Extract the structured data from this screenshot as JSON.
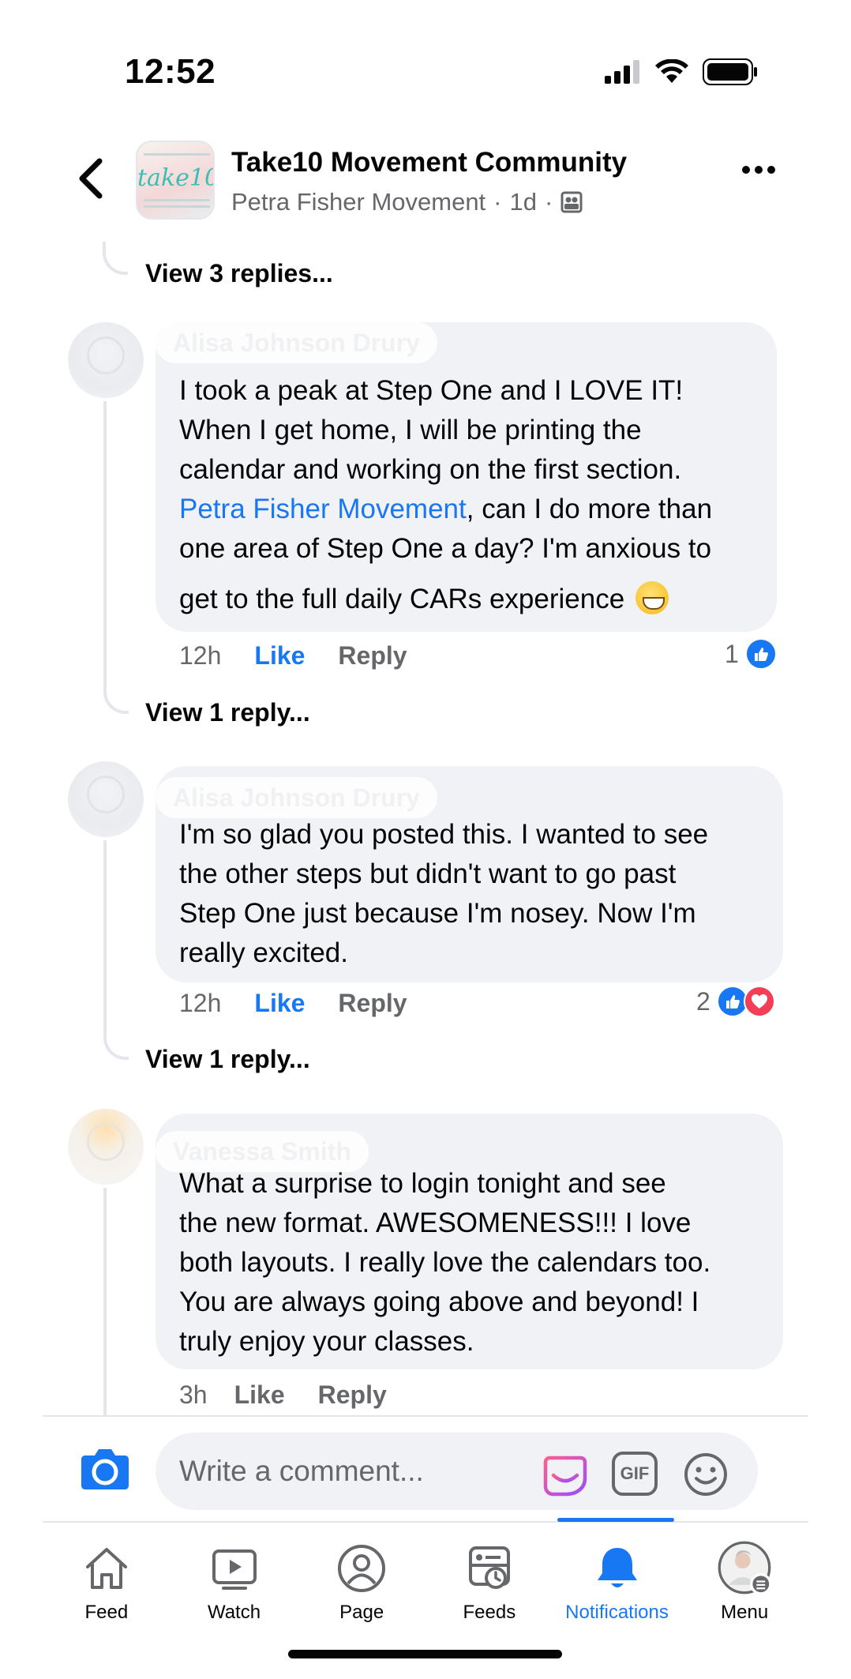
{
  "status_bar": {
    "time": "12:52"
  },
  "header": {
    "group_name": "Take10 Movement Community",
    "page_name": "Petra Fisher Movement",
    "separator": "·",
    "age": "1d",
    "avatar_text": "take10"
  },
  "thread": {
    "top_view_replies": "View 3 replies...",
    "comments": [
      {
        "author": "Alisa Johnson Drury",
        "lines": [
          "I took a peak at Step One and I LOVE IT!",
          "When I  get home, I will be printing the",
          "calendar and working on the first section."
        ],
        "mention": "Petra Fisher Movement",
        "after_mention": ", can I do more than",
        "lines_after": [
          "one area of Step One a day? I'm anxious to",
          "get to the full daily CARs experience"
        ],
        "emoji": "grinning-face-emoji",
        "time": "12h",
        "like": "Like",
        "reply": "Reply",
        "reaction_count": "1",
        "view_replies": "View 1 reply..."
      },
      {
        "author": "Alisa Johnson Drury",
        "lines": [
          "I'm so glad you posted this. I wanted to see",
          "the other steps but didn't want to go past",
          "Step One just because I'm nosey. Now I'm",
          "really excited."
        ],
        "time": "12h",
        "like": "Like",
        "reply": "Reply",
        "reaction_count": "2",
        "view_replies": "View 1 reply..."
      },
      {
        "author": "Vanessa Smith",
        "lines": [
          "What a surprise to login tonight and see",
          "the new format.  AWESOMENESS!!! I love",
          "both layouts. I really love the calendars too.",
          "You are always going above and beyond! I",
          "truly enjoy your classes."
        ],
        "time": "3h",
        "like": "Like",
        "reply": "Reply"
      }
    ]
  },
  "composer": {
    "placeholder": "Write a comment...",
    "gif_label": "GIF"
  },
  "nav": {
    "items": [
      {
        "label": "Feed",
        "icon": "home-icon"
      },
      {
        "label": "Watch",
        "icon": "video-icon"
      },
      {
        "label": "Page",
        "icon": "profile-icon"
      },
      {
        "label": "Feeds",
        "icon": "feeds-icon"
      },
      {
        "label": "Notifications",
        "icon": "bell-icon",
        "active": true
      },
      {
        "label": "Menu",
        "icon": "menu-avatar-icon"
      }
    ]
  },
  "colors": {
    "accent": "#1877f2",
    "secondary_text": "#65676b",
    "bubble": "#f0f2f5",
    "love": "#f33e58"
  }
}
